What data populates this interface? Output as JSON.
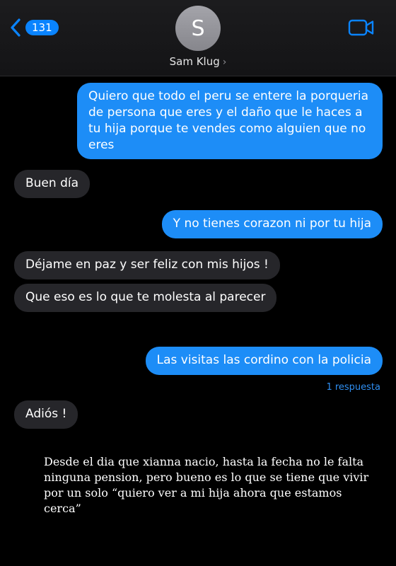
{
  "header": {
    "unread_count": "131",
    "avatar_initial": "S",
    "contact_name": "Sam Klug",
    "contact_chevron": "›",
    "icons": {
      "back": "chevron-left",
      "video": "video-camera"
    },
    "accent": "#0a84ff"
  },
  "messages": [
    {
      "side": "out",
      "text": "Quiero que todo el peru se entere la porqueria de persona que eres y el daño que le haces a tu hija porque te vendes como alguien que no eres"
    },
    {
      "side": "in",
      "text": "Buen día"
    },
    {
      "side": "out",
      "text": "Y no tienes corazon ni por tu hija"
    },
    {
      "side": "in",
      "text": "Déjame en paz y ser feliz con mis hijos !"
    },
    {
      "side": "in",
      "text": "Que eso es lo que te molesta al parecer"
    },
    {
      "side": "out",
      "text": "Las visitas las cordino con la policia"
    },
    {
      "side": "in",
      "text": "Adiós !"
    }
  ],
  "reply_label": "1 respuesta",
  "caption": "Desde el dia que xianna nacio, hasta la fecha no le falta ninguna pension, pero bueno es lo que se tiene que vivir por un solo “quiero ver a mi hija ahora que estamos cerca”",
  "colors": {
    "outgoing": "#1d8df7",
    "incoming": "#26262a",
    "background": "#000000"
  }
}
